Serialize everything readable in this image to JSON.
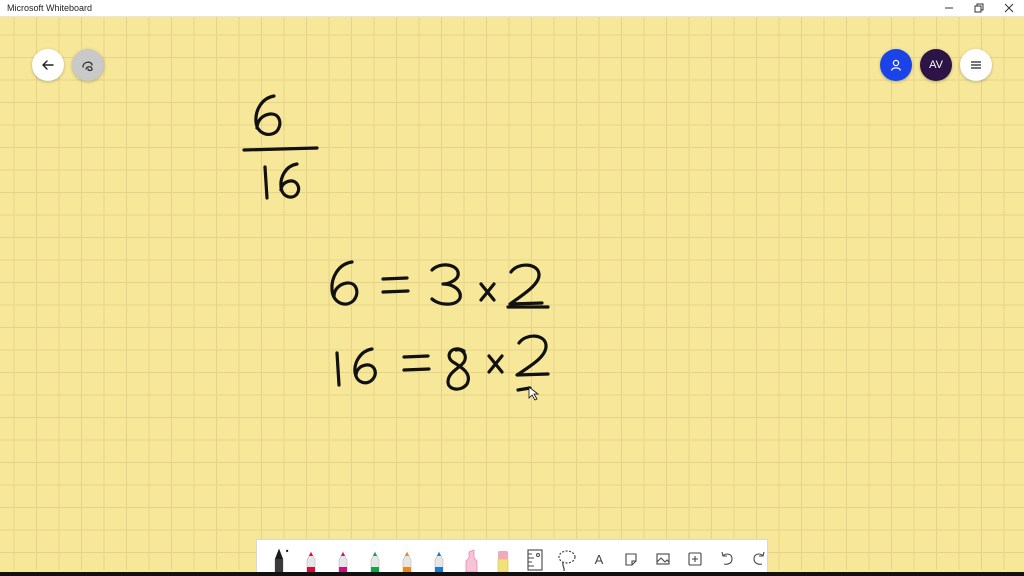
{
  "window": {
    "title": "Microsoft Whiteboard",
    "controls": [
      "minimize-icon",
      "restore-icon",
      "close-icon"
    ]
  },
  "top_left_buttons": [
    {
      "name": "back-button",
      "icon": "arrow-left-icon"
    },
    {
      "name": "ink-beautify-button",
      "icon": "ink-shape-icon"
    }
  ],
  "top_right": {
    "invite_icon": "person-icon",
    "avatar_initials": "AV",
    "menu_icon": "hamburger-icon"
  },
  "board": {
    "fraction": {
      "numerator": "6",
      "denominator": "16"
    },
    "equations": [
      {
        "left": "6",
        "op": "=",
        "a": "3",
        "times": "x",
        "b": "2"
      },
      {
        "left": "16",
        "op": "=",
        "a": "8",
        "times": "x",
        "b": "2"
      }
    ]
  },
  "toolbar": {
    "tools": [
      {
        "name": "pen-black",
        "color": "#1a1a1a",
        "selected": true
      },
      {
        "name": "pen-red",
        "color": "#d0103a"
      },
      {
        "name": "pen-magenta",
        "color": "#c8127a"
      },
      {
        "name": "pen-green",
        "color": "#12a24c"
      },
      {
        "name": "pen-orange",
        "color": "#e8891b"
      },
      {
        "name": "pen-blue",
        "color": "#1f78c8"
      },
      {
        "name": "highlighter",
        "color": "#f29ab8"
      },
      {
        "name": "eraser",
        "color": "#f4a8c0"
      },
      {
        "name": "ruler",
        "icon": "ruler-icon"
      },
      {
        "name": "lasso-select",
        "icon": "lasso-icon"
      },
      {
        "name": "text",
        "icon": "text-icon",
        "label": "A"
      },
      {
        "name": "note",
        "icon": "sticky-note-icon"
      },
      {
        "name": "image",
        "icon": "image-icon"
      },
      {
        "name": "insert",
        "icon": "plus-box-icon"
      },
      {
        "name": "undo",
        "icon": "undo-icon"
      },
      {
        "name": "redo",
        "icon": "redo-icon"
      }
    ]
  }
}
